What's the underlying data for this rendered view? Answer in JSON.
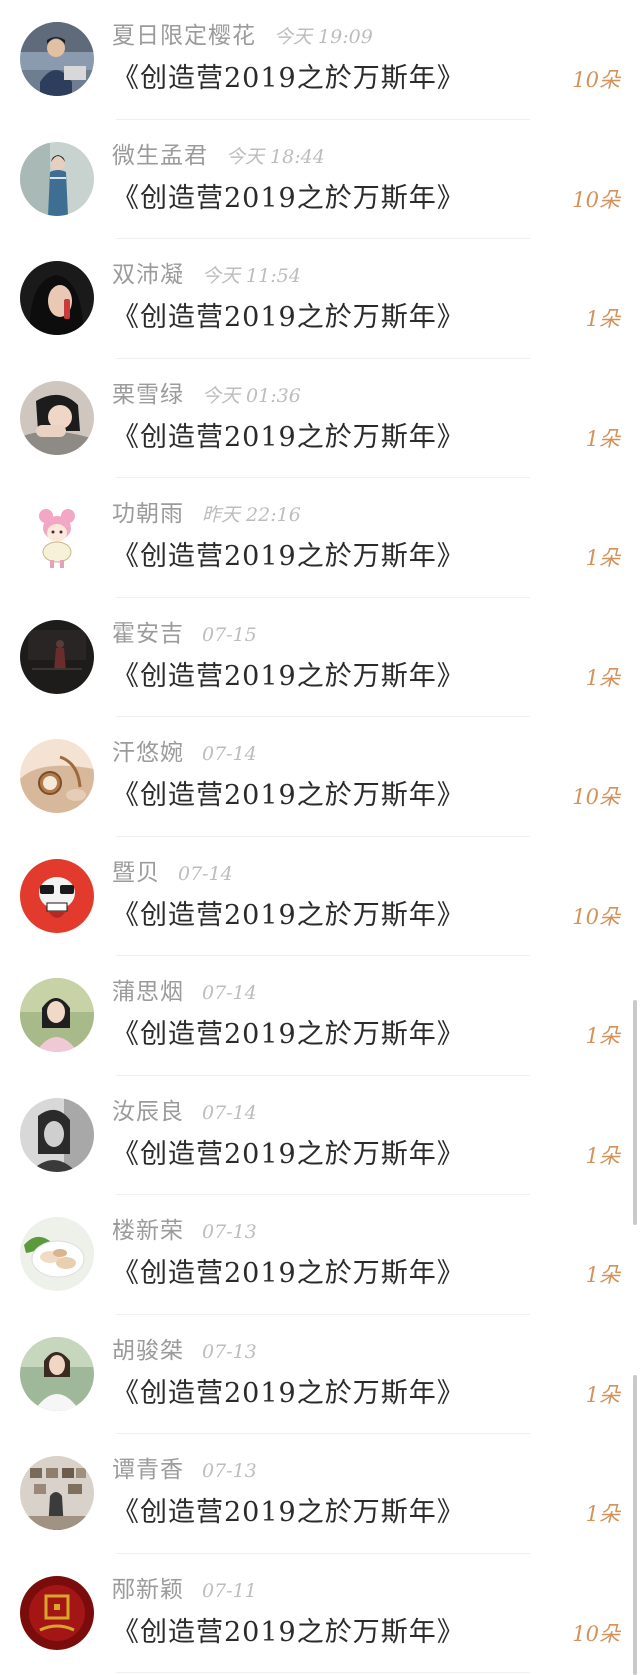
{
  "items": [
    {
      "name": "夏日限定樱花",
      "time": "今天 19:09",
      "title": "《创造营2019之於万斯年》",
      "count": "10朵",
      "avatar": "man-portrait-avatar"
    },
    {
      "name": "微生孟君",
      "time": "今天 18:44",
      "title": "《创造营2019之於万斯年》",
      "count": "10朵",
      "avatar": "qipao-woman-avatar"
    },
    {
      "name": "双沛凝",
      "time": "今天 11:54",
      "title": "《创造营2019之於万斯年》",
      "count": "1朵",
      "avatar": "girl-drinking-avatar"
    },
    {
      "name": "栗雪绿",
      "time": "今天 01:36",
      "title": "《创造营2019之於万斯年》",
      "count": "1朵",
      "avatar": "girl-resting-avatar"
    },
    {
      "name": "功朝雨",
      "time": "昨天 22:16",
      "title": "《创造营2019之於万斯年》",
      "count": "1朵",
      "avatar": "cartoon-girl-avatar"
    },
    {
      "name": "霍安吉",
      "time": "07-15",
      "title": "《创造营2019之於万斯年》",
      "count": "1朵",
      "avatar": "dark-stage-avatar"
    },
    {
      "name": "汗悠婉",
      "time": "07-14",
      "title": "《创造营2019之於万斯年》",
      "count": "10朵",
      "avatar": "pocket-watch-avatar"
    },
    {
      "name": "暨贝",
      "time": "07-14",
      "title": "《创造营2019之於万斯年》",
      "count": "10朵",
      "avatar": "red-skull-avatar"
    },
    {
      "name": "蒲思烟",
      "time": "07-14",
      "title": "《创造营2019之於万斯年》",
      "count": "1朵",
      "avatar": "girl-outdoor-avatar"
    },
    {
      "name": "汝辰良",
      "time": "07-14",
      "title": "《创造营2019之於万斯年》",
      "count": "1朵",
      "avatar": "monochrome-portrait-avatar"
    },
    {
      "name": "楼新荣",
      "time": "07-13",
      "title": "《创造营2019之於万斯年》",
      "count": "1朵",
      "avatar": "dumpling-food-avatar"
    },
    {
      "name": "胡骏桀",
      "time": "07-13",
      "title": "《创造营2019之於万斯年》",
      "count": "1朵",
      "avatar": "woman-white-dress-avatar"
    },
    {
      "name": "谭青香",
      "time": "07-13",
      "title": "《创造营2019之於万斯年》",
      "count": "1朵",
      "avatar": "photo-wall-avatar"
    },
    {
      "name": "邴新颖",
      "time": "07-11",
      "title": "《创造营2019之於万斯年》",
      "count": "10朵",
      "avatar": "red-china-avatar"
    }
  ],
  "colors": {
    "count": "#d4915a",
    "name": "#9b9b9b",
    "time": "#bdbdbd",
    "title": "#2b2b2b"
  }
}
